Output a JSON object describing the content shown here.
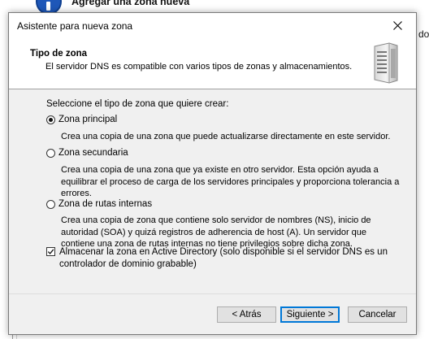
{
  "background": {
    "title": "Agregar una zona nueva",
    "right_fragment": "do"
  },
  "dialog": {
    "title": "Asistente para nueva zona",
    "header_title": "Tipo de zona",
    "header_subtitle": "El servidor DNS es compatible con varios tipos de zonas y almacenamientos.",
    "prompt": "Seleccione el tipo de zona que quiere crear:",
    "options": [
      {
        "label": "Zona principal",
        "checked": true,
        "description": "Crea una copia de una zona que puede actualizarse directamente en este servidor."
      },
      {
        "label": "Zona secundaria",
        "checked": false,
        "description": "Crea una copia de una zona que ya existe en otro servidor. Esta opción ayuda a equilibrar el proceso de carga de los servidores principales y proporciona tolerancia a errores."
      },
      {
        "label": "Zona de rutas internas",
        "checked": false,
        "description": "Crea una copia de zona que contiene solo servidor de nombres (NS), inicio de autoridad (SOA) y quizá registros de adherencia de host (A). Un servidor que contiene una zona de rutas internas no tiene privilegios sobre dicha zona."
      }
    ],
    "ad_checkbox": {
      "label": "Almacenar la zona en Active Directory (solo disponible si el servidor DNS es un controlador de dominio grabable)",
      "checked": true
    },
    "buttons": {
      "back": "< Atrás",
      "next": "Siguiente >",
      "cancel": "Cancelar"
    }
  }
}
